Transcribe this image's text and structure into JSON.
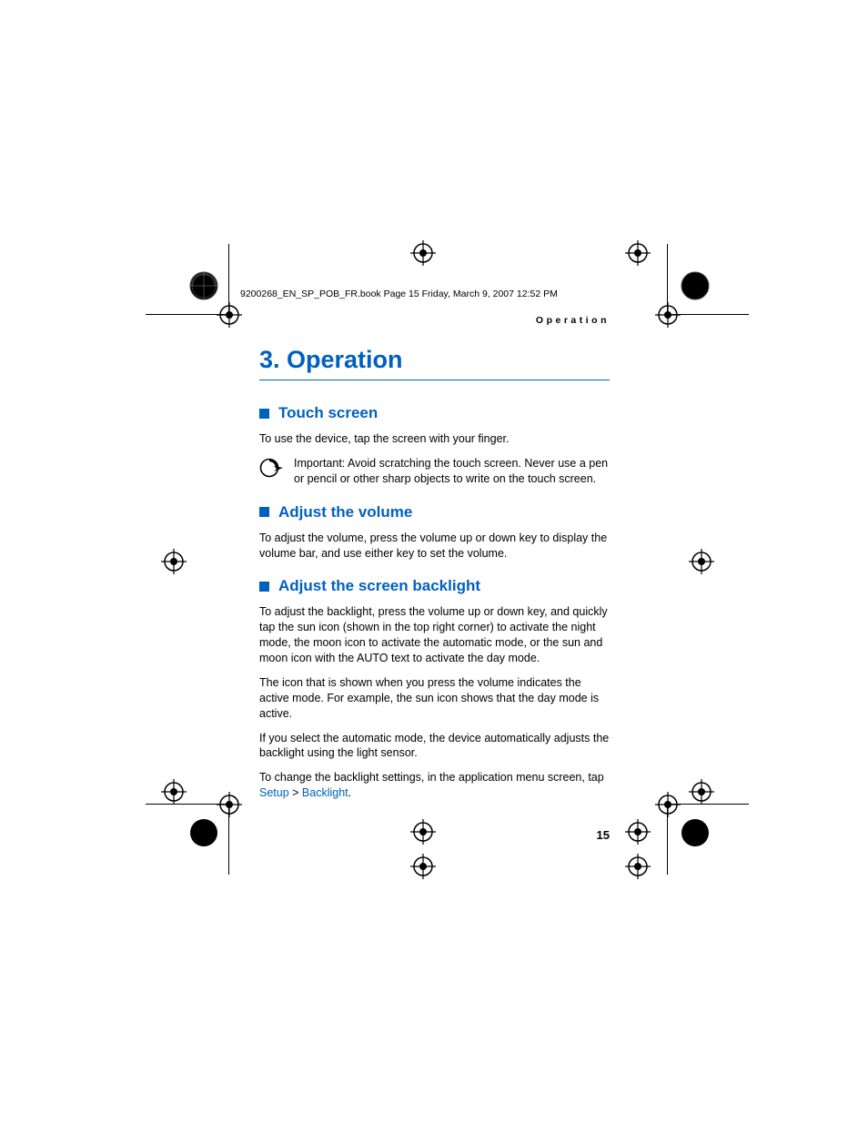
{
  "running_info": "9200268_EN_SP_POB_FR.book  Page 15  Friday, March 9, 2007  12:52 PM",
  "running_header": "Operation",
  "chapter_title": "3.   Operation",
  "page_number": "15",
  "sections": [
    {
      "heading": "Touch screen",
      "paras": [
        "To use the device, tap the screen with your finger."
      ],
      "important": "Important: Avoid scratching the touch screen. Never use a pen or pencil or other sharp objects to write on the touch screen."
    },
    {
      "heading": "Adjust the volume",
      "paras": [
        "To adjust the volume, press the volume up or down key to display the volume bar, and use either key to set the volume."
      ]
    },
    {
      "heading": "Adjust the screen backlight",
      "paras": [
        "To adjust the backlight, press the volume up or down key, and quickly tap the sun icon (shown in the top right corner) to activate the night mode, the moon icon to activate the automatic mode, or the sun and moon icon with the AUTO text to activate the day mode.",
        "The icon that is shown when you press the volume indicates the active mode. For example, the sun icon shows that the day mode is active.",
        "If you select the automatic mode, the device automatically adjusts the backlight using the light sensor."
      ],
      "trailing": {
        "prefix": "To change the backlight settings, in the application menu screen, tap ",
        "link1": "Setup",
        "sep": " > ",
        "link2": "Backlight",
        "suffix": "."
      }
    }
  ]
}
